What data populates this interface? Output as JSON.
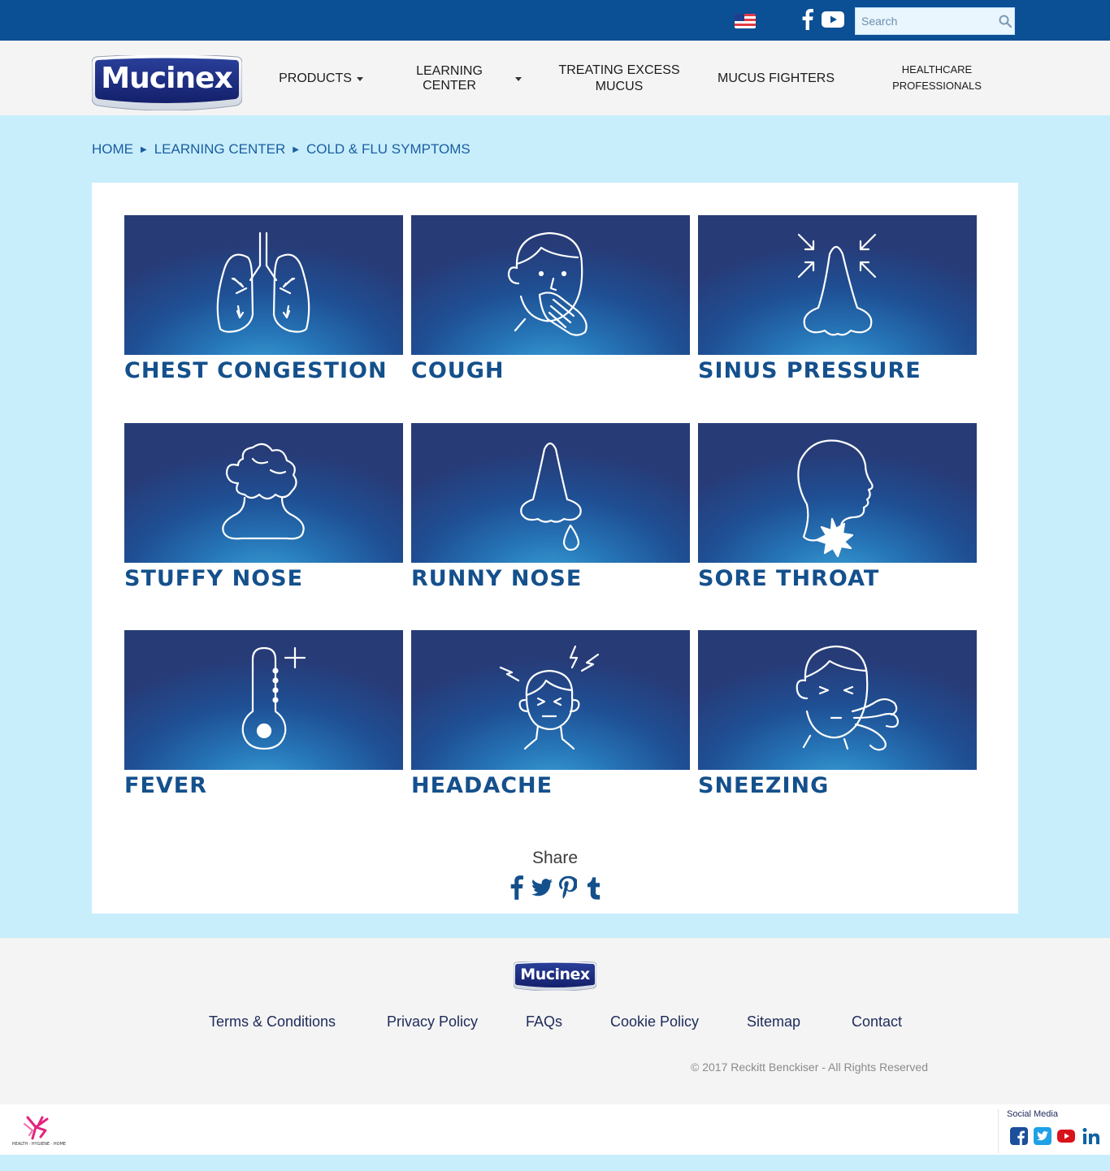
{
  "header": {
    "brand": "Mucinex",
    "search": {
      "placeholder": "Search"
    },
    "social": [
      "facebook-icon",
      "youtube-icon"
    ],
    "locale_flag": "us-flag-icon"
  },
  "nav": {
    "products": "PRODUCTS",
    "learning_center": "LEARNING CENTER",
    "treating_line1": "TREATING EXCESS",
    "treating_line2": "MUCUS",
    "mucus_fighters": "MUCUS FIGHTERS",
    "hcp_line1": "HEALTHCARE",
    "hcp_line2": "PROFESSIONALS"
  },
  "breadcrumb": {
    "home": "HOME",
    "learning_center": "LEARNING CENTER",
    "current": "COLD & FLU SYMPTOMS"
  },
  "symptoms": [
    {
      "label": "CHEST CONGESTION",
      "icon": "lungs-icon"
    },
    {
      "label": "COUGH",
      "icon": "coughing-face-icon"
    },
    {
      "label": "SINUS PRESSURE",
      "icon": "nose-pressure-icon"
    },
    {
      "label": "STUFFY NOSE",
      "icon": "stuffy-nose-icon"
    },
    {
      "label": "RUNNY NOSE",
      "icon": "runny-nose-icon"
    },
    {
      "label": "SORE THROAT",
      "icon": "sore-throat-icon"
    },
    {
      "label": "FEVER",
      "icon": "thermometer-icon"
    },
    {
      "label": "HEADACHE",
      "icon": "headache-icon"
    },
    {
      "label": "SNEEZING",
      "icon": "sneezing-face-icon"
    }
  ],
  "share": {
    "label": "Share",
    "icons": [
      "facebook-icon",
      "twitter-icon",
      "pinterest-icon",
      "tumblr-icon"
    ]
  },
  "footer": {
    "brand": "Mucinex",
    "links": {
      "terms": "Terms & Conditions",
      "privacy": "Privacy Policy",
      "faqs": "FAQs",
      "cookie": "Cookie Policy",
      "sitemap": "Sitemap",
      "contact": "Contact"
    },
    "copyright": "© 2017 Reckitt Benckiser - All Rights Reserved"
  },
  "bottom": {
    "rb_tagline": "HEALTH · HYGIENE · HOME",
    "social_title": "Social Media",
    "social_icons": [
      "facebook-icon",
      "twitter-icon",
      "youtube-icon",
      "linkedin-icon"
    ]
  },
  "colors": {
    "topbar": "#0b4f94",
    "page_background": "#c8eefc",
    "heading_blue": "#14508c",
    "tile_dark": "#273b77",
    "tile_glow": "#3aa3d8"
  }
}
